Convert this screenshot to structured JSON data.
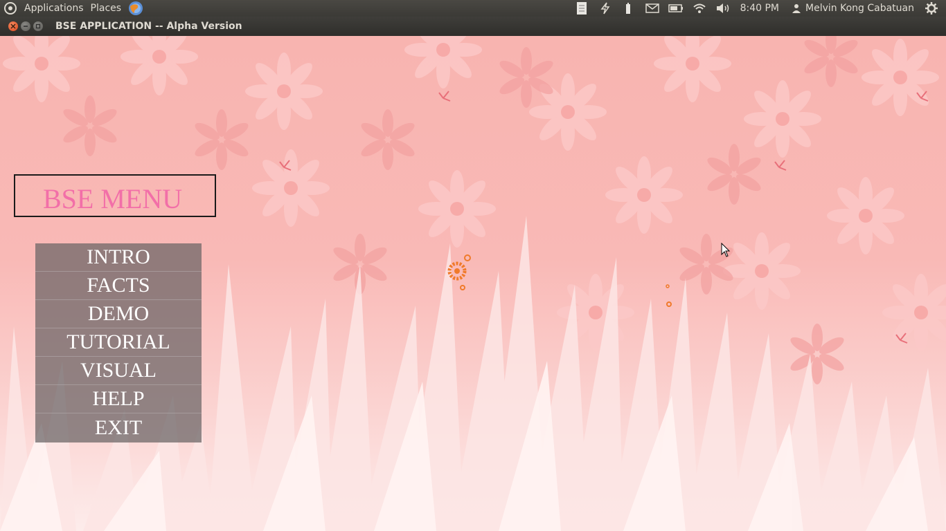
{
  "panel": {
    "applications": "Applications",
    "places": "Places",
    "clock": "8:40 PM",
    "user": "Melvin Kong Cabatuan",
    "icons": [
      "ubuntu-logo-icon",
      "web-browser-icon",
      "document-icon",
      "power-icon",
      "battery-small-icon",
      "mail-icon",
      "battery-icon",
      "wifi-icon",
      "volume-icon",
      "user-icon",
      "settings-gear-icon"
    ]
  },
  "window": {
    "title": "BSE APPLICATION -- Alpha Version"
  },
  "app": {
    "menu_title": "BSE MENU",
    "menu_items": [
      "INTRO",
      "FACTS",
      "DEMO",
      "TUTORIAL",
      "VISUAL",
      "HELP",
      "EXIT"
    ]
  },
  "colors": {
    "menu_title": "#f26fa8",
    "menu_bg": "#686264",
    "background": "#f8b4b0",
    "accent_orange": "#f07a2a"
  }
}
